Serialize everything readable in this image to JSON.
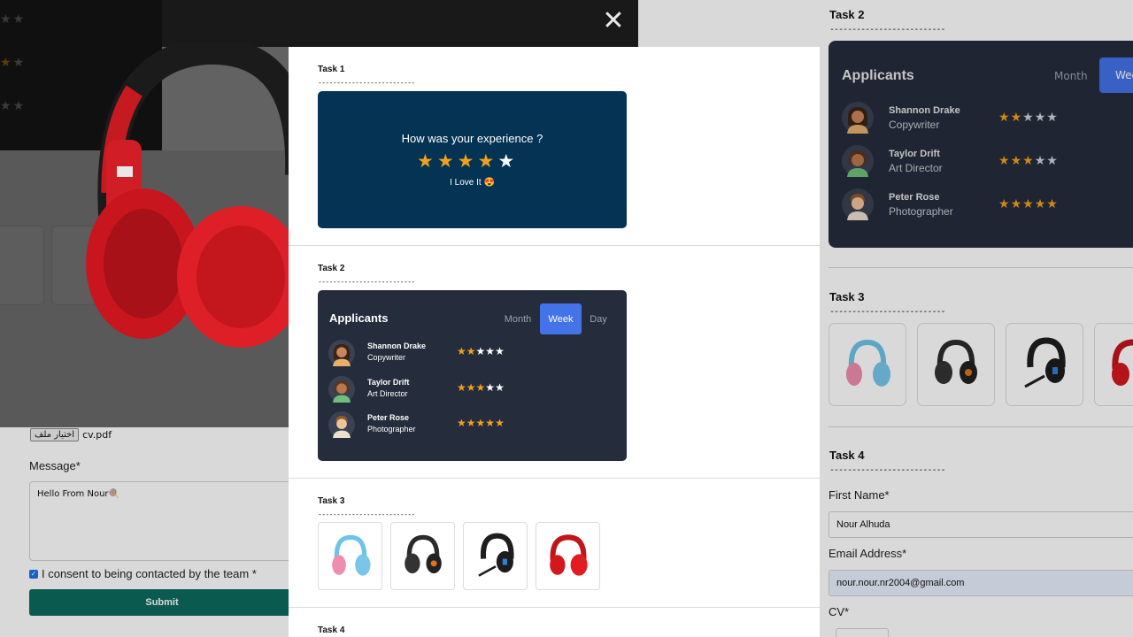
{
  "background_form": {
    "file_button": "اختيار ملف",
    "file_name": "cv.pdf",
    "message_label": "Message*",
    "message_value": "Hello From Nour🍭",
    "consent_label": "I consent to being contacted by the team *",
    "submit_label": "Submit"
  },
  "modal": {
    "close_symbol": "✕",
    "task1": {
      "title": "Task 1",
      "dashes": "--------------------------",
      "question": "How was your experience ?",
      "rating": 4,
      "max_rating": 5,
      "message": "I Love It 😍"
    },
    "task2": {
      "title": "Task 2",
      "dashes": "--------------------------",
      "card_title": "Applicants",
      "tabs": [
        {
          "label": "Month",
          "active": false
        },
        {
          "label": "Week",
          "active": true
        },
        {
          "label": "Day",
          "active": false
        }
      ],
      "applicants": [
        {
          "name": "Shannon Drake",
          "role": "Copywriter",
          "rating": 2,
          "icon": "avatar-woman-dark-hair-icon"
        },
        {
          "name": "Taylor Drift",
          "role": "Art Director",
          "rating": 3,
          "icon": "avatar-woman-green-shirt-icon"
        },
        {
          "name": "Peter Rose",
          "role": "Photographer",
          "rating": 5,
          "icon": "avatar-man-icon"
        }
      ]
    },
    "task3": {
      "title": "Task 3",
      "dashes": "--------------------------",
      "products": [
        "pink-blue-headphones-icon",
        "black-gaming-headset-icon",
        "black-mic-headset-icon",
        "red-headphones-icon"
      ]
    },
    "task4": {
      "title": "Task 4"
    }
  },
  "right_panel": {
    "task2_title": "Task 2",
    "task3_title": "Task 3",
    "task4_title": "Task 4",
    "dashes": "--------------------------",
    "card_title": "Applicants",
    "tab_month": "Month",
    "tab_week": "Wee",
    "applicants": [
      {
        "name": "Shannon Drake",
        "role": "Copywriter",
        "rating": 2
      },
      {
        "name": "Taylor Drift",
        "role": "Art Director",
        "rating": 3
      },
      {
        "name": "Peter Rose",
        "role": "Photographer",
        "rating": 5
      }
    ],
    "first_name_label": "First Name*",
    "first_name_value": "Nour Alhuda",
    "email_label": "Email Address*",
    "email_value": "nour.nour.nr2004@gmail.com",
    "cv_label": "CV*"
  },
  "colors": {
    "star": "#f0a21b",
    "experience_card": "#043354",
    "applicants_card": "#252c3c",
    "active_tab": "#4472e8",
    "submit": "#0d6a5e"
  }
}
